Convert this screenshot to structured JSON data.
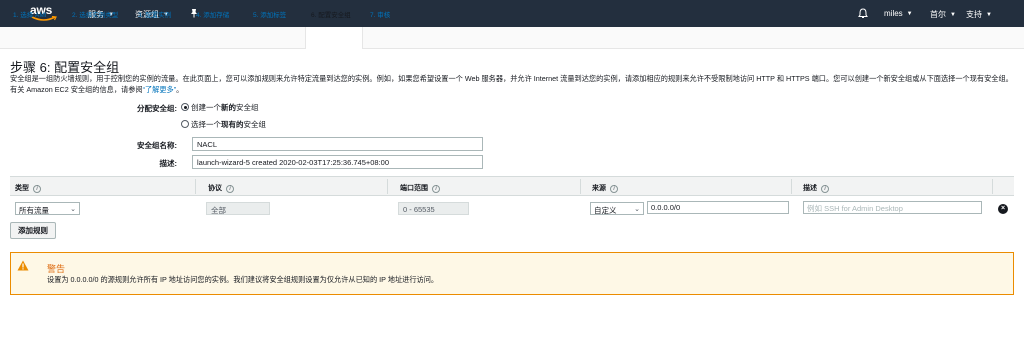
{
  "nav": {
    "logo": "aws",
    "services": "服务",
    "resource_groups": "资源组",
    "user": "miles",
    "region": "首尔",
    "support": "支持"
  },
  "wizard_tabs": [
    {
      "label": "1. 选择 AMI"
    },
    {
      "label": "2. 选择实例类型"
    },
    {
      "label": "3. 配置实例"
    },
    {
      "label": "4. 添加存储"
    },
    {
      "label": "5. 添加标签"
    },
    {
      "label": "6. 配置安全组"
    },
    {
      "label": "7. 审核"
    }
  ],
  "page": {
    "title": "步骤 6: 配置安全组",
    "description_1": "安全组是一组防火墙规则，用于控制您的实例的流量。在此页面上，您可以添加规则来允许特定流量到达您的实例。例如，如果您希望设置一个 Web 服务器，并允许 Internet 流量到达您的实例，请添加相应的规则来允许不受限制地访问 HTTP 和 HTTPS 端口。您可以创建一个新安全组或从下面选择一个现有安全组。有关 Amazon EC2 安全组的信息，请参阅",
    "description_link": "“了解更多”",
    "description_end": "。"
  },
  "form": {
    "assign_label": "分配安全组:",
    "option_create_1": "创建一个",
    "option_create_bold": "新的",
    "option_create_2": "安全组",
    "option_select_1": "选择一个",
    "option_select_bold": "现有的",
    "option_select_2": "安全组",
    "name_label": "安全组名称:",
    "name_value": "NACL",
    "desc_label": "描述:",
    "desc_value": "launch-wizard-5 created 2020-02-03T17:25:36.745+08:00"
  },
  "table": {
    "headers": [
      "类型",
      "协议",
      "端口范围",
      "来源",
      "描述"
    ],
    "info_glyph": "i",
    "row": {
      "type": "所有流量",
      "protocol": "全部",
      "port_range": "0 - 65535",
      "source_type": "自定义",
      "source_cidr": "0.0.0.0/0",
      "description_placeholder": "例如 SSH for Admin Desktop"
    }
  },
  "add_rule_button": "添加规则",
  "warning": {
    "title": "警告",
    "text": "设置为 0.0.0.0/0 的源规则允许所有 IP 地址访问您的实例。我们建议将安全组规则设置为仅允许从已知的 IP 地址进行访问。"
  },
  "colors": {
    "nav_bg": "#232f3e",
    "link": "#0073bb",
    "warning_border": "#eb8c00",
    "warning_bg": "#fef8e6",
    "warning_title": "#dd6b10"
  }
}
